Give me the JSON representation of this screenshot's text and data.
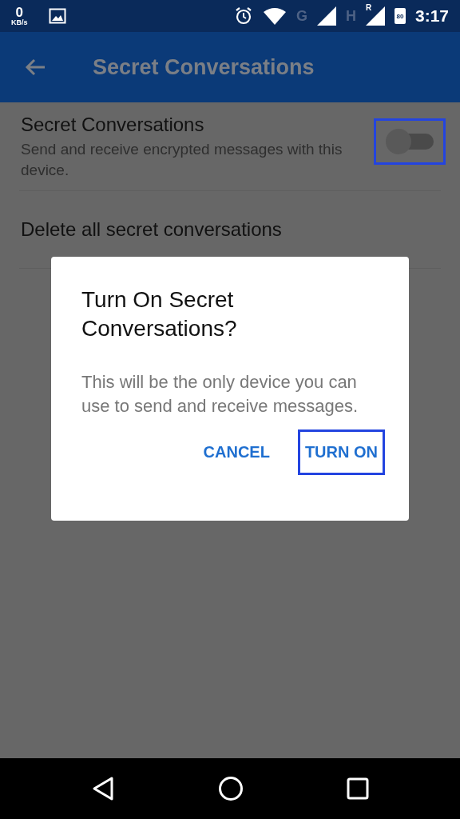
{
  "status_bar": {
    "speed_value": "0",
    "speed_unit": "KB/s",
    "network_1": "G",
    "network_2": "H",
    "roaming": "R",
    "battery": "80",
    "time": "3:17"
  },
  "app_bar": {
    "title": "Secret Conversations"
  },
  "settings": [
    {
      "kind": "toggle",
      "title": "Secret Conversations",
      "subtitle": "Send and receive encrypted messages with this device.",
      "on": false,
      "highlighted": true
    },
    {
      "kind": "action",
      "title": "Delete all secret conversations"
    }
  ],
  "dialog": {
    "title": "Turn On Secret Conversations?",
    "body": "This will be the only device you can use to send and receive messages.",
    "buttons": [
      {
        "label": "CANCEL",
        "highlighted": false
      },
      {
        "label": "TURN ON",
        "highlighted": true
      }
    ]
  }
}
